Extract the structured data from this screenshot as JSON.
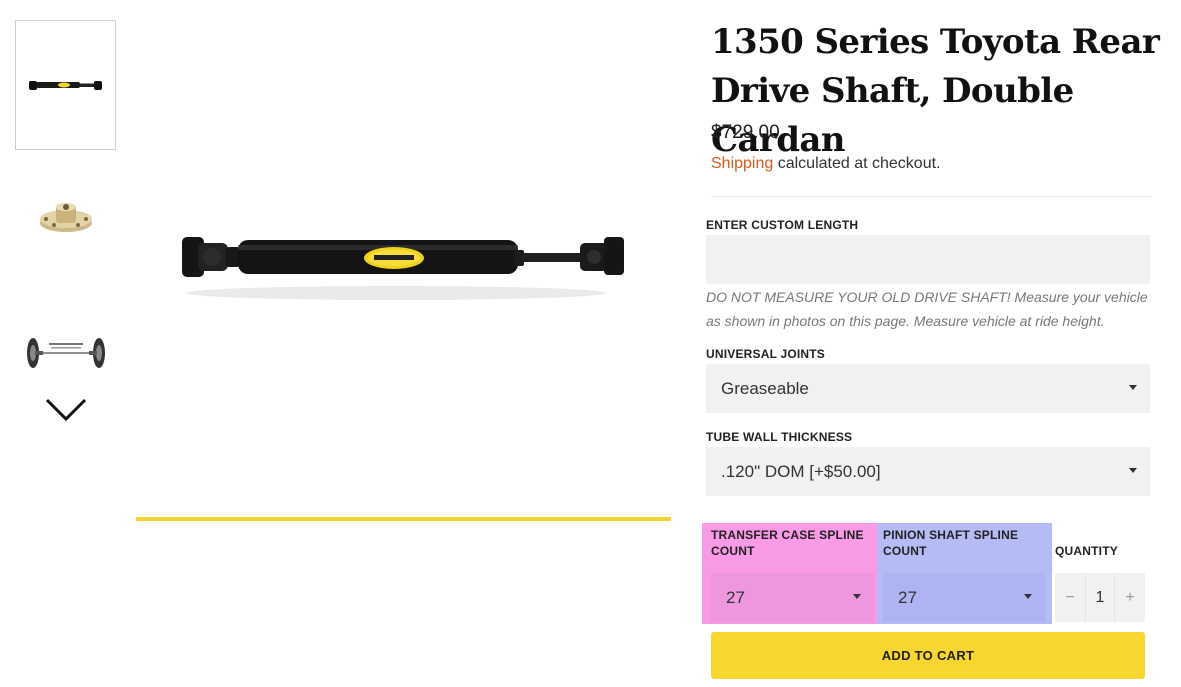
{
  "product": {
    "title": "1350 Series Toyota Rear Drive Shaft, Double Cardan",
    "price": "$729.00",
    "shipping_link": "Shipping",
    "shipping_suffix": " calculated at checkout."
  },
  "gallery": {
    "thumbnails": [
      {
        "icon": "drive-shaft-thumbnail",
        "selected": true
      },
      {
        "icon": "yoke-flange-thumbnail",
        "selected": false
      },
      {
        "icon": "measurement-diagram-thumbnail",
        "selected": false
      }
    ],
    "next_icon": "chevron-down-icon",
    "progress_bar_color": "#f2d42f"
  },
  "options": {
    "custom_length": {
      "label": "ENTER CUSTOM LENGTH",
      "value": "",
      "hint": "DO NOT MEASURE YOUR OLD DRIVE SHAFT! Measure your vehicle as shown in photos on this page. Measure vehicle at ride height."
    },
    "universal_joints": {
      "label": "UNIVERSAL JOINTS",
      "value": "Greaseable"
    },
    "tube_wall": {
      "label": "TUBE WALL THICKNESS",
      "value": ".120\" DOM [+$50.00]"
    },
    "transfer_case_spline": {
      "label": "TRANSFER CASE SPLINE COUNT",
      "value": "27",
      "highlight": "#f99ae6"
    },
    "pinion_shaft_spline": {
      "label": "PINION SHAFT SPLINE COUNT",
      "value": "27",
      "highlight": "#b5bbf4"
    },
    "quantity": {
      "label": "QUANTITY",
      "value": "1",
      "minus": "−",
      "plus": "+"
    }
  },
  "actions": {
    "add_to_cart": "ADD TO CART",
    "button_color": "#f7d62f"
  },
  "colors": {
    "link": "#d35b1e",
    "field_bg": "#f1f1f1"
  }
}
